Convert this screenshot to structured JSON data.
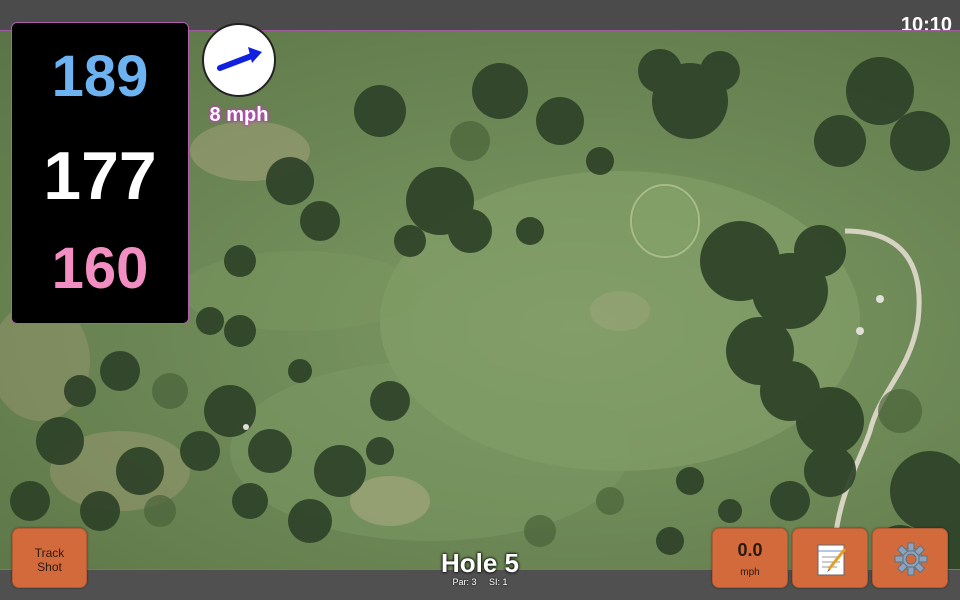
{
  "status": {
    "time": "10:10"
  },
  "distances": {
    "back": "189",
    "middle": "177",
    "front": "160"
  },
  "wind": {
    "speed": "8 mph",
    "icon": "wind-direction-arrow-icon"
  },
  "hole": {
    "title": "Hole 5",
    "par": "Par: 3",
    "si": "SI: 1"
  },
  "buttons": {
    "track_shot_line1": "Track",
    "track_shot_line2": "Shot",
    "speed_value": "0.0",
    "speed_unit": "mph",
    "notes_icon": "notepad-icon",
    "settings_icon": "gear-icon"
  },
  "colors": {
    "back_distance": "#6db3f2",
    "middle_distance": "#ffffff",
    "front_distance": "#f28ec2",
    "button_orange": "#d26a3c",
    "frame_border": "#b05fb0"
  }
}
